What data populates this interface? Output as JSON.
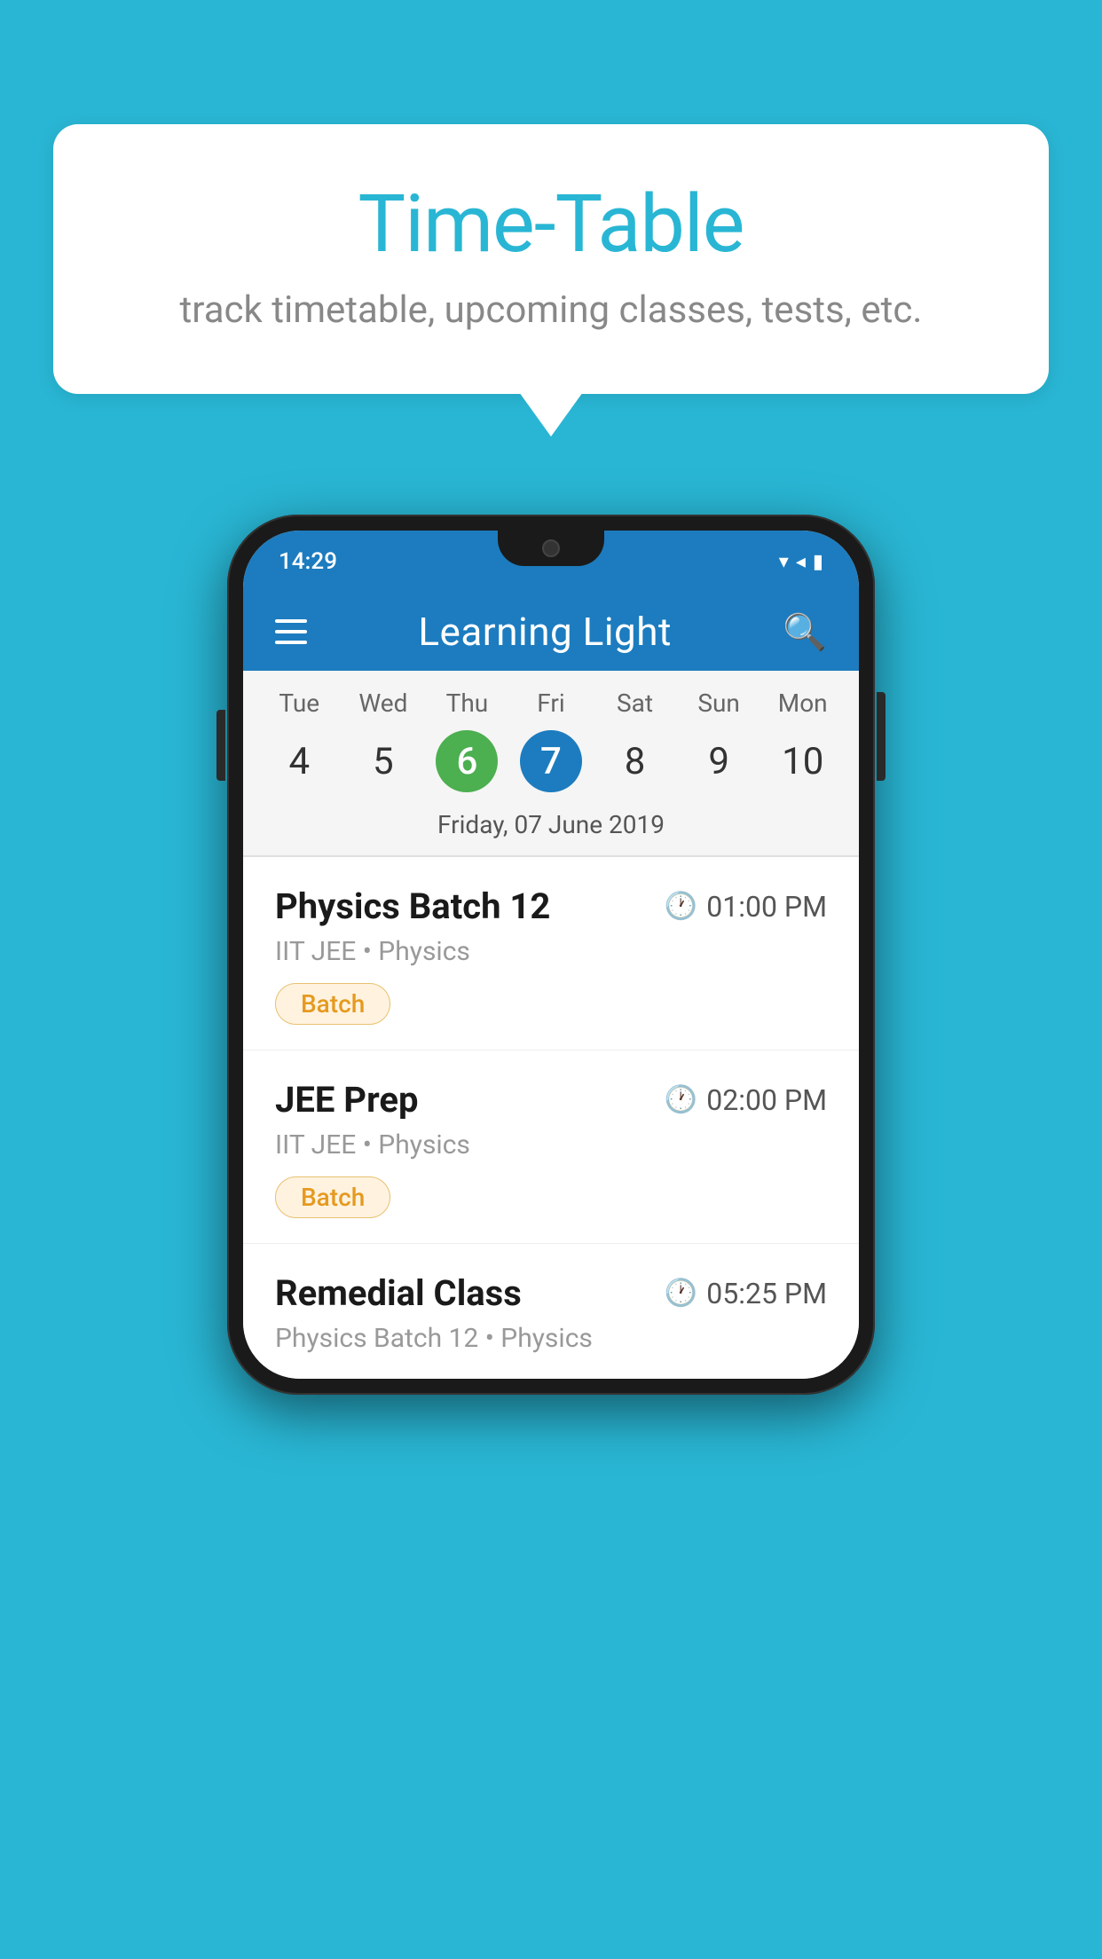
{
  "background": {
    "color": "#29b6d4"
  },
  "speech_bubble": {
    "title": "Time-Table",
    "subtitle": "track timetable, upcoming classes, tests, etc."
  },
  "phone": {
    "status_bar": {
      "time": "14:29",
      "signal_icons": "▾◂▮"
    },
    "app_header": {
      "title": "Learning Light",
      "menu_label": "hamburger-menu",
      "search_label": "search"
    },
    "calendar": {
      "days": [
        "Tue",
        "Wed",
        "Thu",
        "Fri",
        "Sat",
        "Sun",
        "Mon"
      ],
      "dates": [
        "4",
        "5",
        "6",
        "7",
        "8",
        "9",
        "10"
      ],
      "today_index": 2,
      "selected_index": 3,
      "selected_date_label": "Friday, 07 June 2019"
    },
    "events": [
      {
        "name": "Physics Batch 12",
        "time": "01:00 PM",
        "meta": "IIT JEE • Physics",
        "badge": "Batch"
      },
      {
        "name": "JEE Prep",
        "time": "02:00 PM",
        "meta": "IIT JEE • Physics",
        "badge": "Batch"
      },
      {
        "name": "Remedial Class",
        "time": "05:25 PM",
        "meta": "Physics Batch 12 • Physics",
        "badge": null
      }
    ]
  }
}
